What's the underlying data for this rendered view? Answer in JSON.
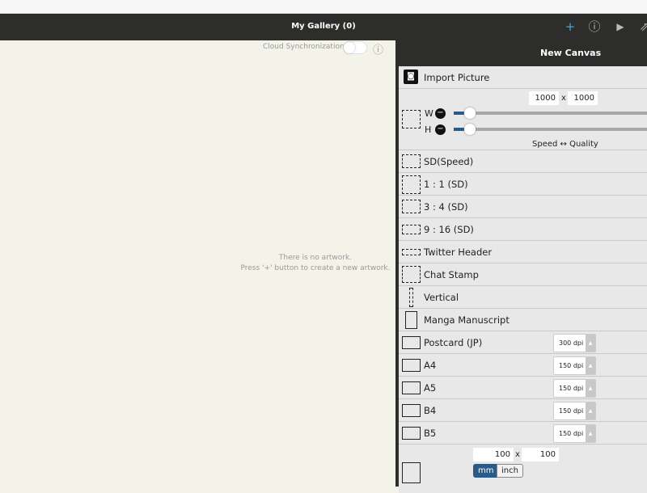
{
  "header": {
    "title": "My Gallery (0)",
    "icons": [
      "plus-icon",
      "info-icon",
      "play-icon",
      "share-icon"
    ]
  },
  "cloud": {
    "label": "Cloud Synchronization",
    "enabled": false
  },
  "empty": {
    "line1": "There is no artwork.",
    "line2": "Press '+' button to create a new artwork."
  },
  "panel": {
    "title": "New Canvas",
    "import_label": "Import Picture",
    "custom": {
      "width": "1000",
      "height": "1000",
      "x": "x",
      "w_label": "W",
      "h_label": "H",
      "scale_label": "Speed ↔ Quality"
    },
    "presets": [
      {
        "label": "SD(Speed)"
      },
      {
        "label": "1 : 1 (SD)"
      },
      {
        "label": "3 : 4 (SD)"
      },
      {
        "label": "9 : 16 (SD)"
      },
      {
        "label": "Twitter Header"
      },
      {
        "label": "Chat Stamp"
      },
      {
        "label": "Vertical"
      },
      {
        "label": "Manga Manuscript"
      }
    ],
    "paper": [
      {
        "label": "Postcard (JP)",
        "dpi": "300 dpi"
      },
      {
        "label": "A4",
        "dpi": "150 dpi"
      },
      {
        "label": "A5",
        "dpi": "150 dpi"
      },
      {
        "label": "B4",
        "dpi": "150 dpi"
      },
      {
        "label": "B5",
        "dpi": "150 dpi"
      }
    ],
    "paper_custom": {
      "width": "100",
      "height": "100",
      "x": "x",
      "unit_mm": "mm",
      "unit_inch": "inch",
      "selected_unit": "mm"
    },
    "accent": "#2a5a88"
  }
}
